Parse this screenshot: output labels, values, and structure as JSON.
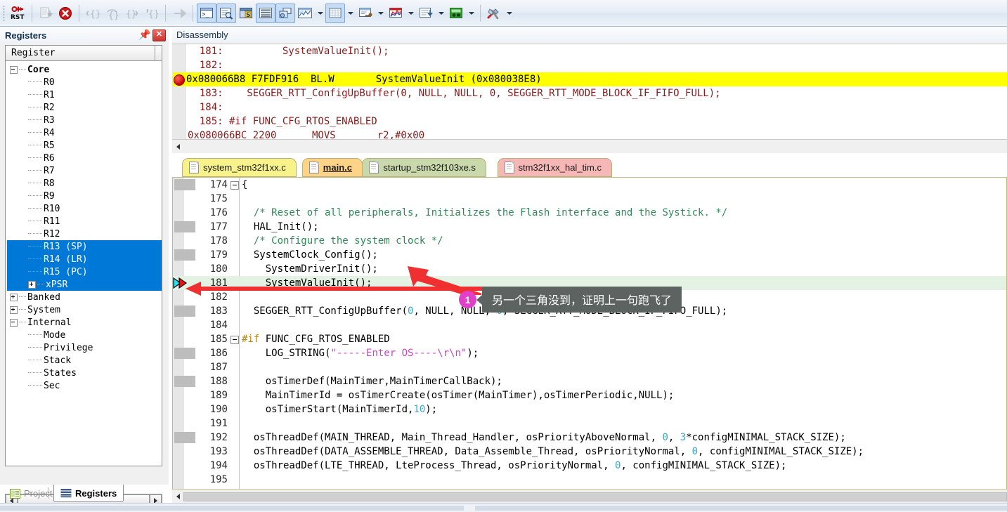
{
  "toolbar": {
    "buttons": [
      {
        "name": "reset-cpu",
        "label": "RST",
        "enabled": true,
        "active": false
      },
      {
        "name": "run-to-cursor",
        "label": "Run to Cursor Line",
        "enabled": false,
        "active": false
      },
      {
        "name": "stop-debug",
        "label": "Stop",
        "enabled": true,
        "active": false
      },
      {
        "name": "step-into",
        "label": "Step",
        "enabled": false,
        "active": false
      },
      {
        "name": "step-over",
        "label": "Step Over",
        "enabled": false,
        "active": false
      },
      {
        "name": "step-out",
        "label": "Step Out",
        "enabled": false,
        "active": false
      },
      {
        "name": "step-out-return",
        "label": "Step Out of Current Function",
        "enabled": false,
        "active": false
      },
      {
        "name": "show-next-statement",
        "label": "Show Next Statement",
        "enabled": false,
        "active": false
      },
      {
        "name": "command-window",
        "label": "Command Window",
        "enabled": true,
        "active": true
      },
      {
        "name": "disassembly-window",
        "label": "Disassembly Window",
        "enabled": true,
        "active": true
      },
      {
        "name": "symbol-window",
        "label": "Symbol Window",
        "enabled": true,
        "active": false
      },
      {
        "name": "registers-window",
        "label": "Registers Window",
        "enabled": true,
        "active": true
      },
      {
        "name": "call-stack-window",
        "label": "Call Stack Window",
        "enabled": true,
        "active": true
      },
      {
        "name": "watch-windows",
        "label": "Watch Windows",
        "enabled": true,
        "active": false
      },
      {
        "name": "memory-windows",
        "label": "Memory Windows",
        "enabled": true,
        "active": true
      },
      {
        "name": "serial-windows",
        "label": "Serial Windows",
        "enabled": true,
        "active": false
      },
      {
        "name": "analysis-windows",
        "label": "Analysis Windows",
        "enabled": true,
        "active": false
      },
      {
        "name": "trace-windows",
        "label": "Trace Windows",
        "enabled": true,
        "active": false
      },
      {
        "name": "system-viewer",
        "label": "System Viewer",
        "enabled": true,
        "active": false
      },
      {
        "name": "toolbox",
        "label": "Toolbox",
        "enabled": true,
        "active": false
      }
    ]
  },
  "registers_panel": {
    "title": "Registers",
    "pin_icon": "pin-icon",
    "close_icon": "close-icon",
    "column_header": "Register",
    "tree": [
      {
        "label": "Core",
        "depth": 0,
        "expander": "minus",
        "bold": true,
        "selected": false
      },
      {
        "label": "R0",
        "depth": 1,
        "expander": "none",
        "bold": false,
        "selected": false
      },
      {
        "label": "R1",
        "depth": 1,
        "expander": "none",
        "bold": false,
        "selected": false
      },
      {
        "label": "R2",
        "depth": 1,
        "expander": "none",
        "bold": false,
        "selected": false
      },
      {
        "label": "R3",
        "depth": 1,
        "expander": "none",
        "bold": false,
        "selected": false
      },
      {
        "label": "R4",
        "depth": 1,
        "expander": "none",
        "bold": false,
        "selected": false
      },
      {
        "label": "R5",
        "depth": 1,
        "expander": "none",
        "bold": false,
        "selected": false
      },
      {
        "label": "R6",
        "depth": 1,
        "expander": "none",
        "bold": false,
        "selected": false
      },
      {
        "label": "R7",
        "depth": 1,
        "expander": "none",
        "bold": false,
        "selected": false
      },
      {
        "label": "R8",
        "depth": 1,
        "expander": "none",
        "bold": false,
        "selected": false
      },
      {
        "label": "R9",
        "depth": 1,
        "expander": "none",
        "bold": false,
        "selected": false
      },
      {
        "label": "R10",
        "depth": 1,
        "expander": "none",
        "bold": false,
        "selected": false
      },
      {
        "label": "R11",
        "depth": 1,
        "expander": "none",
        "bold": false,
        "selected": false
      },
      {
        "label": "R12",
        "depth": 1,
        "expander": "none",
        "bold": false,
        "selected": false
      },
      {
        "label": "R13 (SP)",
        "depth": 1,
        "expander": "none",
        "bold": false,
        "selected": true
      },
      {
        "label": "R14 (LR)",
        "depth": 1,
        "expander": "none",
        "bold": false,
        "selected": true
      },
      {
        "label": "R15 (PC)",
        "depth": 1,
        "expander": "none",
        "bold": false,
        "selected": true
      },
      {
        "label": "xPSR",
        "depth": 1,
        "expander": "plus",
        "bold": false,
        "selected": true
      },
      {
        "label": "Banked",
        "depth": 0,
        "expander": "plus",
        "bold": false,
        "selected": false
      },
      {
        "label": "System",
        "depth": 0,
        "expander": "plus",
        "bold": false,
        "selected": false
      },
      {
        "label": "Internal",
        "depth": 0,
        "expander": "minus",
        "bold": false,
        "selected": false
      },
      {
        "label": "Mode",
        "depth": 1,
        "expander": "none",
        "bold": false,
        "selected": false
      },
      {
        "label": "Privilege",
        "depth": 1,
        "expander": "none",
        "bold": false,
        "selected": false
      },
      {
        "label": "Stack",
        "depth": 1,
        "expander": "none",
        "bold": false,
        "selected": false
      },
      {
        "label": "States",
        "depth": 1,
        "expander": "none",
        "bold": false,
        "selected": false
      },
      {
        "label": "Sec",
        "depth": 1,
        "expander": "none",
        "bold": false,
        "selected": false
      }
    ]
  },
  "bottom_tabs": [
    {
      "label": "Project",
      "icon": "project-icon",
      "active": false
    },
    {
      "label": "Registers",
      "icon": "registers-icon",
      "active": true
    }
  ],
  "disassembly": {
    "title": "Disassembly",
    "lines": [
      {
        "text": "  181:          SystemValueInit();",
        "highlight": false,
        "breakpoint": false
      },
      {
        "text": "  182:  ",
        "highlight": false,
        "breakpoint": false
      },
      {
        "text": "0x080066B8 F7FDF916  BL.W       SystemValueInit (0x080038E8)",
        "highlight": true,
        "breakpoint": true
      },
      {
        "text": "  183:    SEGGER_RTT_ConfigUpBuffer(0, NULL, NULL, 0, SEGGER_RTT_MODE_BLOCK_IF_FIFO_FULL);",
        "highlight": false,
        "breakpoint": false
      },
      {
        "text": "  184:  ",
        "highlight": false,
        "breakpoint": false
      },
      {
        "text": "  185: #if FUNC_CFG_RTOS_ENABLED",
        "highlight": false,
        "breakpoint": false
      },
      {
        "text": "0x080066BC 2200      MOVS       r2,#0x00",
        "highlight": false,
        "breakpoint": false
      }
    ]
  },
  "editor": {
    "file_tabs": [
      {
        "label": "system_stm32f1xx.c",
        "color": "#f7f289",
        "active": false
      },
      {
        "label": "main.c",
        "color": "#ffd486",
        "active": true
      },
      {
        "label": "startup_stm32f103xe.s",
        "color": "#c9d9ab",
        "active": false
      },
      {
        "label": "stm32f1xx_hal_tim.c",
        "color": "#f6b7b7",
        "active": false
      }
    ],
    "lines": [
      {
        "num": "174",
        "text": "{",
        "fold": true,
        "marker": true,
        "current": false,
        "pc": false
      },
      {
        "num": "175",
        "text": "",
        "fold": false,
        "marker": false,
        "current": false,
        "pc": false
      },
      {
        "num": "176",
        "text": "  /* Reset of all peripherals, Initializes the Flash interface and the Systick. */",
        "fold": false,
        "marker": false,
        "current": false,
        "pc": false
      },
      {
        "num": "177",
        "text": "  HAL_Init();",
        "fold": false,
        "marker": true,
        "current": false,
        "pc": false
      },
      {
        "num": "178",
        "text": "  /* Configure the system clock */",
        "fold": false,
        "marker": false,
        "current": false,
        "pc": false
      },
      {
        "num": "179",
        "text": "  SystemClock_Config();",
        "fold": false,
        "marker": true,
        "current": false,
        "pc": false
      },
      {
        "num": "180",
        "text": "    SystemDriverInit();",
        "fold": false,
        "marker": false,
        "current": false,
        "pc": false
      },
      {
        "num": "181",
        "text": "    SystemValueInit();",
        "fold": false,
        "marker": false,
        "current": true,
        "pc": true
      },
      {
        "num": "182",
        "text": "",
        "fold": false,
        "marker": false,
        "current": false,
        "pc": false
      },
      {
        "num": "183",
        "text": "  SEGGER_RTT_ConfigUpBuffer(0, NULL, NULL, 0, SEGGER_RTT_MODE_BLOCK_IF_FIFO_FULL);",
        "fold": false,
        "marker": true,
        "current": false,
        "pc": false
      },
      {
        "num": "184",
        "text": "",
        "fold": false,
        "marker": false,
        "current": false,
        "pc": false
      },
      {
        "num": "185",
        "text": "#if FUNC_CFG_RTOS_ENABLED",
        "fold": true,
        "marker": false,
        "current": false,
        "pc": false
      },
      {
        "num": "186",
        "text": "    LOG_STRING(\"-----Enter OS----\\r\\n\");",
        "fold": false,
        "marker": true,
        "current": false,
        "pc": false
      },
      {
        "num": "187",
        "text": "",
        "fold": false,
        "marker": false,
        "current": false,
        "pc": false
      },
      {
        "num": "188",
        "text": "    osTimerDef(MainTimer,MainTimerCallBack);",
        "fold": false,
        "marker": true,
        "current": false,
        "pc": false
      },
      {
        "num": "189",
        "text": "    MainTimerId = osTimerCreate(osTimer(MainTimer),osTimerPeriodic,NULL);",
        "fold": false,
        "marker": false,
        "current": false,
        "pc": false
      },
      {
        "num": "190",
        "text": "    osTimerStart(MainTimerId,10);",
        "fold": false,
        "marker": false,
        "current": false,
        "pc": false
      },
      {
        "num": "191",
        "text": "",
        "fold": false,
        "marker": false,
        "current": false,
        "pc": false
      },
      {
        "num": "192",
        "text": "  osThreadDef(MAIN_THREAD, Main_Thread_Handler, osPriorityAboveNormal, 0, 3*configMINIMAL_STACK_SIZE);",
        "fold": false,
        "marker": true,
        "current": false,
        "pc": false
      },
      {
        "num": "193",
        "text": "  osThreadDef(DATA_ASSEMBLE_THREAD, Data_Assemble_Thread, osPriorityNormal, 0, configMINIMAL_STACK_SIZE);",
        "fold": false,
        "marker": false,
        "current": false,
        "pc": false
      },
      {
        "num": "194",
        "text": "  osThreadDef(LTE_THREAD, LteProcess_Thread, osPriorityNormal, 0, configMINIMAL_STACK_SIZE);",
        "fold": false,
        "marker": false,
        "current": false,
        "pc": false
      },
      {
        "num": "195",
        "text": "",
        "fold": false,
        "marker": false,
        "current": false,
        "pc": false
      }
    ]
  },
  "annotations": {
    "callout": {
      "badge": "1",
      "text": "另一个三角没到，证明上一句跑飞了"
    },
    "arrow_color": "#f03030"
  },
  "colors": {
    "highlight_yellow": "#ffff00",
    "current_line_green": "#e4f2e4",
    "selection_blue": "#0078d7",
    "breakpoint_red": "#cc0000",
    "annotation_pink": "#e040c8",
    "annotation_bubble": "#5c6360"
  }
}
